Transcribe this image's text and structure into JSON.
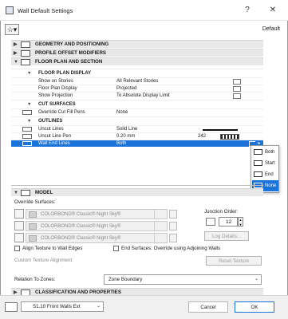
{
  "window": {
    "title": "Wall Default Settings",
    "help": "?",
    "close": "✕"
  },
  "toolbar": {
    "favorites": "☆▾",
    "default_label": "Default"
  },
  "sections": {
    "geometry": "GEOMETRY AND POSITIONING",
    "profile": "PROFILE OFFSET MODIFIERS",
    "floor_plan": "FLOOR PLAN AND SECTION",
    "model": "MODEL",
    "classification": "CLASSIFICATION AND PROPERTIES"
  },
  "floor_plan_display": {
    "header": "FLOOR PLAN DISPLAY",
    "rows": [
      {
        "label": "Show on Stories",
        "value": "All Relevant Stories"
      },
      {
        "label": "Floor Plan Display",
        "value": "Projected"
      },
      {
        "label": "Show Projection",
        "value": "To Absolute Display Limit"
      }
    ]
  },
  "cut_surfaces": {
    "header": "CUT SURFACES",
    "rows": [
      {
        "label": "Override Cut Fill Pens",
        "value": "None"
      }
    ]
  },
  "outlines": {
    "header": "OUTLINES",
    "rows": [
      {
        "label": "Uncut Lines",
        "value": "Solid Line"
      },
      {
        "label": "Uncut Line Pen",
        "value": "0.20 mm",
        "pen": "242"
      },
      {
        "label": "Wall End Lines",
        "value": "Both"
      }
    ]
  },
  "end_lines_popup": {
    "options": [
      "Both",
      "Start",
      "End",
      "None"
    ],
    "highlighted": "None"
  },
  "model": {
    "override_label": "Override Surfaces:",
    "surfaces": [
      "COLORBOND® Classic® Night Sky®",
      "COLORBOND® Classic® Night Sky®",
      "COLORBOND® Classic® Night Sky®"
    ],
    "junction_label": "Junction Order:",
    "junction_value": "12",
    "log_details": "Log Details...",
    "align_texture": "Align Texture to Wall Edges",
    "end_surfaces": "End Surfaces: Override using Adjoining Walls",
    "custom_alignment": "Custom Texture Alignment:",
    "reset_texture": "Reset Texture",
    "relation_label": "Relation To Zones:",
    "relation_value": "Zone Boundary"
  },
  "footer": {
    "layer": "S1.10 Front Walls Ext",
    "cancel": "Cancel",
    "ok": "OK"
  },
  "colors": {
    "selection": "#1a73d8",
    "section_bg": "#e8e8e8"
  }
}
